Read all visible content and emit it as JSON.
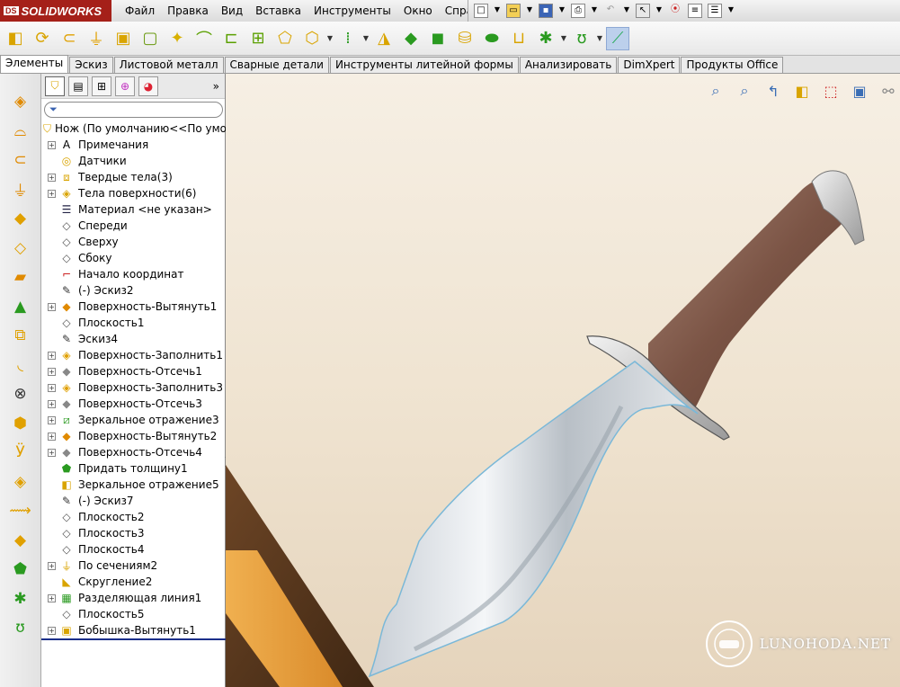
{
  "app": {
    "logo": "SOLIDWORKS",
    "logo_prefix": "DS"
  },
  "menu": {
    "items": [
      "Файл",
      "Правка",
      "Вид",
      "Вставка",
      "Инструменты",
      "Окно",
      "Справка"
    ]
  },
  "tabs": {
    "items": [
      {
        "label": "Элементы",
        "active": true
      },
      {
        "label": "Эскиз",
        "active": false
      },
      {
        "label": "Листовой металл",
        "active": false
      },
      {
        "label": "Сварные детали",
        "active": false
      },
      {
        "label": "Инструменты литейной формы",
        "active": false
      },
      {
        "label": "Анализировать",
        "active": false
      },
      {
        "label": "DimXpert",
        "active": false
      },
      {
        "label": "Продукты Office",
        "active": false
      }
    ]
  },
  "tree": {
    "root": "Нож  (По умолчанию<<По умолч",
    "nodes": [
      {
        "label": "Примечания",
        "icon": "annotation-icon",
        "expandable": true
      },
      {
        "label": "Датчики",
        "icon": "sensor-icon",
        "expandable": false
      },
      {
        "label": "Твердые тела(3)",
        "icon": "solid-bodies-icon",
        "expandable": true
      },
      {
        "label": "Тела поверхности(6)",
        "icon": "surface-bodies-icon",
        "expandable": true
      },
      {
        "label": "Материал <не указан>",
        "icon": "material-icon",
        "expandable": false
      },
      {
        "label": "Спереди",
        "icon": "plane-icon",
        "expandable": false
      },
      {
        "label": "Сверху",
        "icon": "plane-icon",
        "expandable": false
      },
      {
        "label": "Сбоку",
        "icon": "plane-icon",
        "expandable": false
      },
      {
        "label": "Начало координат",
        "icon": "origin-icon",
        "expandable": false
      },
      {
        "label": "(-) Эскиз2",
        "icon": "sketch-icon",
        "expandable": false
      },
      {
        "label": "Поверхность-Вытянуть1",
        "icon": "surface-extrude-icon",
        "expandable": true
      },
      {
        "label": "Плоскость1",
        "icon": "plane-icon",
        "expandable": false
      },
      {
        "label": "Эскиз4",
        "icon": "sketch-icon",
        "expandable": false
      },
      {
        "label": "Поверхность-Заполнить1",
        "icon": "surface-fill-icon",
        "expandable": true
      },
      {
        "label": "Поверхность-Отсечь1",
        "icon": "surface-trim-icon",
        "expandable": true
      },
      {
        "label": "Поверхность-Заполнить3",
        "icon": "surface-fill-icon",
        "expandable": true
      },
      {
        "label": "Поверхность-Отсечь3",
        "icon": "surface-trim-icon",
        "expandable": true
      },
      {
        "label": "Зеркальное отражение3",
        "icon": "mirror-icon",
        "expandable": true
      },
      {
        "label": "Поверхность-Вытянуть2",
        "icon": "surface-extrude-icon",
        "expandable": true
      },
      {
        "label": "Поверхность-Отсечь4",
        "icon": "surface-trim-icon",
        "expandable": true
      },
      {
        "label": "Придать толщину1",
        "icon": "thicken-icon",
        "expandable": false
      },
      {
        "label": "Зеркальное отражение5",
        "icon": "mirror-body-icon",
        "expandable": false
      },
      {
        "label": "(-) Эскиз7",
        "icon": "sketch-icon",
        "expandable": false
      },
      {
        "label": "Плоскость2",
        "icon": "plane-icon",
        "expandable": false
      },
      {
        "label": "Плоскость3",
        "icon": "plane-icon",
        "expandable": false
      },
      {
        "label": "Плоскость4",
        "icon": "plane-icon",
        "expandable": false
      },
      {
        "label": "По сечениям2",
        "icon": "loft-icon",
        "expandable": true
      },
      {
        "label": "Скругление2",
        "icon": "fillet-icon",
        "expandable": false
      },
      {
        "label": "Разделяющая линия1",
        "icon": "split-line-icon",
        "expandable": true
      },
      {
        "label": "Плоскость5",
        "icon": "plane-icon",
        "expandable": false
      },
      {
        "label": "Бобышка-Вытянуть1",
        "icon": "boss-extrude-icon",
        "expandable": true
      }
    ]
  },
  "watermark": {
    "text": "LUNOHODA.NET"
  },
  "colors": {
    "accent": "#3a6db5",
    "logo_red": "#a52019",
    "handle_brown": "#7a5040",
    "board_orange": "#e7a13f"
  }
}
